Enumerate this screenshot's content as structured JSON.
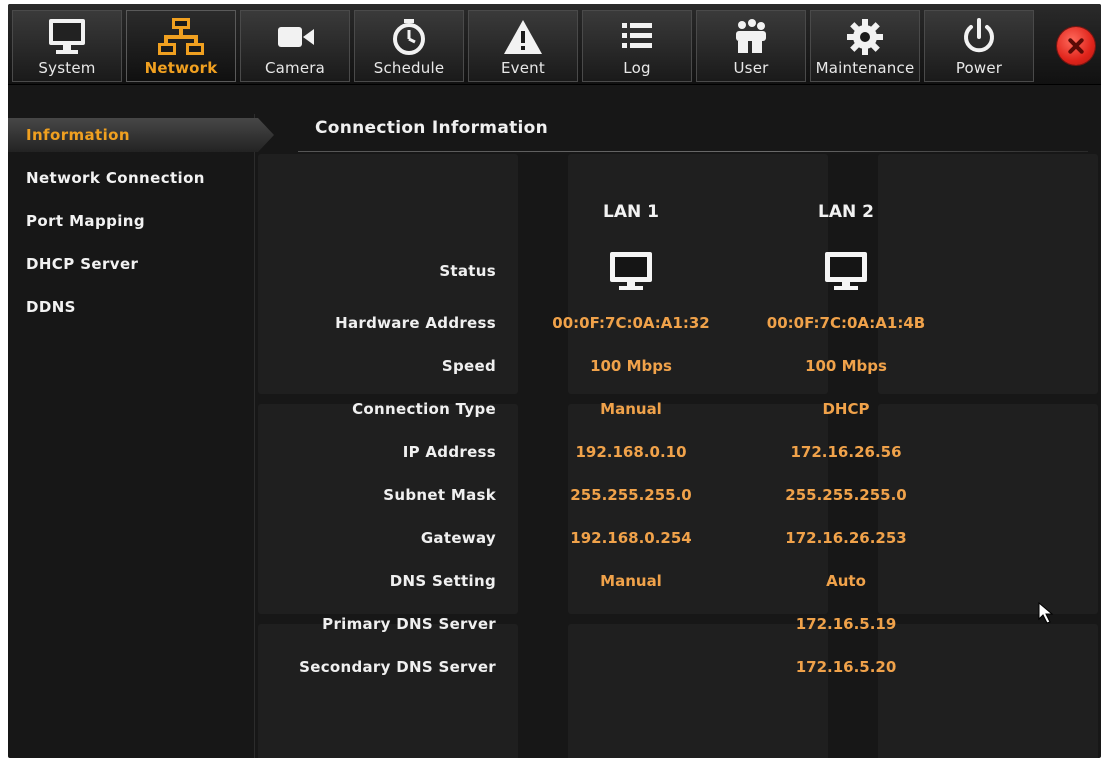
{
  "toolbar": {
    "tabs": [
      {
        "label": "System",
        "icon": "monitor-icon"
      },
      {
        "label": "Network",
        "icon": "network-icon"
      },
      {
        "label": "Camera",
        "icon": "camera-icon"
      },
      {
        "label": "Schedule",
        "icon": "clock-icon"
      },
      {
        "label": "Event",
        "icon": "warning-icon"
      },
      {
        "label": "Log",
        "icon": "list-icon"
      },
      {
        "label": "User",
        "icon": "users-icon"
      },
      {
        "label": "Maintenance",
        "icon": "gear-icon"
      },
      {
        "label": "Power",
        "icon": "power-icon"
      }
    ],
    "active_tab": "Network",
    "close_icon": "close-icon"
  },
  "sidebar": {
    "items": [
      {
        "label": "Information"
      },
      {
        "label": "Network Connection"
      },
      {
        "label": "Port Mapping"
      },
      {
        "label": "DHCP Server"
      },
      {
        "label": "DDNS"
      }
    ],
    "active_item": "Information"
  },
  "main": {
    "title": "Connection Information",
    "columns": [
      "LAN 1",
      "LAN 2"
    ],
    "rows": [
      {
        "label": "Status",
        "lan1": "",
        "lan2": ""
      },
      {
        "label": "Hardware Address",
        "lan1": "00:0F:7C:0A:A1:32",
        "lan2": "00:0F:7C:0A:A1:4B"
      },
      {
        "label": "Speed",
        "lan1": "100 Mbps",
        "lan2": "100 Mbps"
      },
      {
        "label": "Connection Type",
        "lan1": "Manual",
        "lan2": "DHCP"
      },
      {
        "label": "IP Address",
        "lan1": "192.168.0.10",
        "lan2": "172.16.26.56"
      },
      {
        "label": "Subnet Mask",
        "lan1": "255.255.255.0",
        "lan2": "255.255.255.0"
      },
      {
        "label": "Gateway",
        "lan1": "192.168.0.254",
        "lan2": "172.16.26.253"
      },
      {
        "label": "DNS Setting",
        "lan1": "Manual",
        "lan2": "Auto"
      },
      {
        "label": "Primary DNS Server",
        "lan1": "",
        "lan2": "172.16.5.19"
      },
      {
        "label": "Secondary DNS Server",
        "lan1": "",
        "lan2": "172.16.5.20"
      }
    ],
    "status_icon": "monitor-icon"
  },
  "colors": {
    "accent": "#f0a020",
    "value": "#f0a24a",
    "background": "#171717",
    "close": "#e0241b"
  }
}
